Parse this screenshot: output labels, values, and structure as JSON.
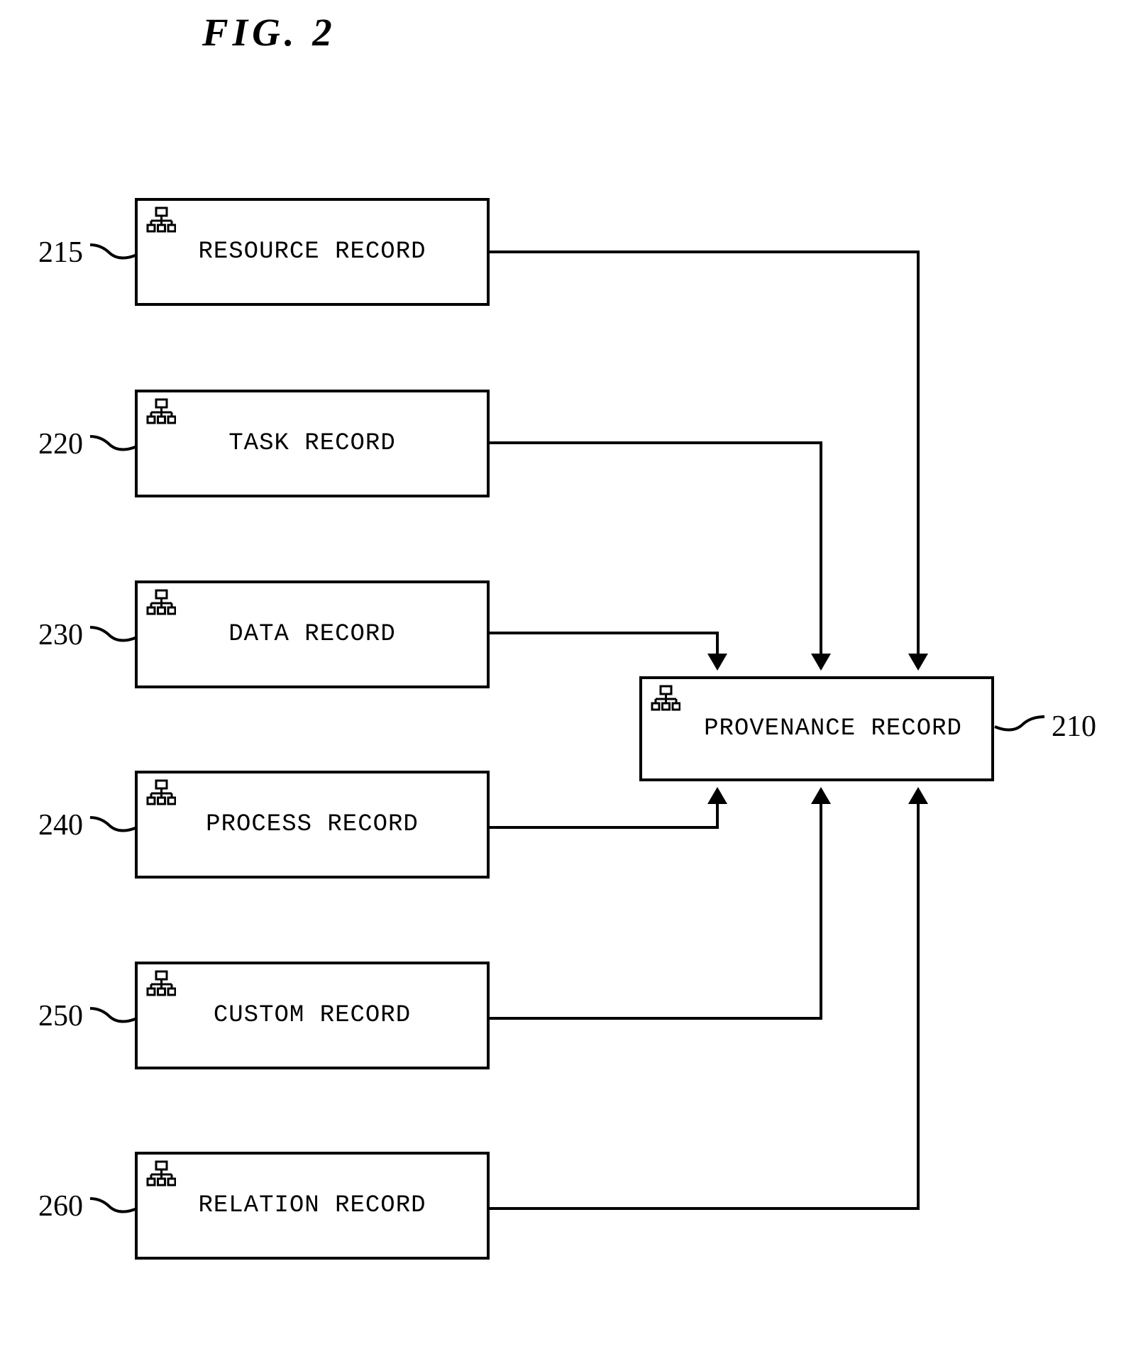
{
  "figure": {
    "title": "FIG.  2"
  },
  "nodes": [
    {
      "id": "resource",
      "label": "RESOURCE RECORD",
      "ref": "215",
      "icon": "network-node-icon"
    },
    {
      "id": "task",
      "label": "TASK RECORD",
      "ref": "220",
      "icon": "network-node-icon"
    },
    {
      "id": "data",
      "label": "DATA RECORD",
      "ref": "230",
      "icon": "network-node-icon"
    },
    {
      "id": "process",
      "label": "PROCESS RECORD",
      "ref": "240",
      "icon": "network-node-icon"
    },
    {
      "id": "custom",
      "label": "CUSTOM RECORD",
      "ref": "250",
      "icon": "network-node-icon"
    },
    {
      "id": "relation",
      "label": "RELATION RECORD",
      "ref": "260",
      "icon": "network-node-icon"
    },
    {
      "id": "provenance",
      "label": "PROVENANCE RECORD",
      "ref": "210",
      "icon": "network-node-icon"
    }
  ],
  "connections": [
    {
      "from": "resource",
      "to": "provenance"
    },
    {
      "from": "task",
      "to": "provenance"
    },
    {
      "from": "data",
      "to": "provenance"
    },
    {
      "from": "process",
      "to": "provenance"
    },
    {
      "from": "custom",
      "to": "provenance"
    },
    {
      "from": "relation",
      "to": "provenance"
    }
  ],
  "colors": {
    "stroke": "#000000",
    "background": "#ffffff"
  }
}
